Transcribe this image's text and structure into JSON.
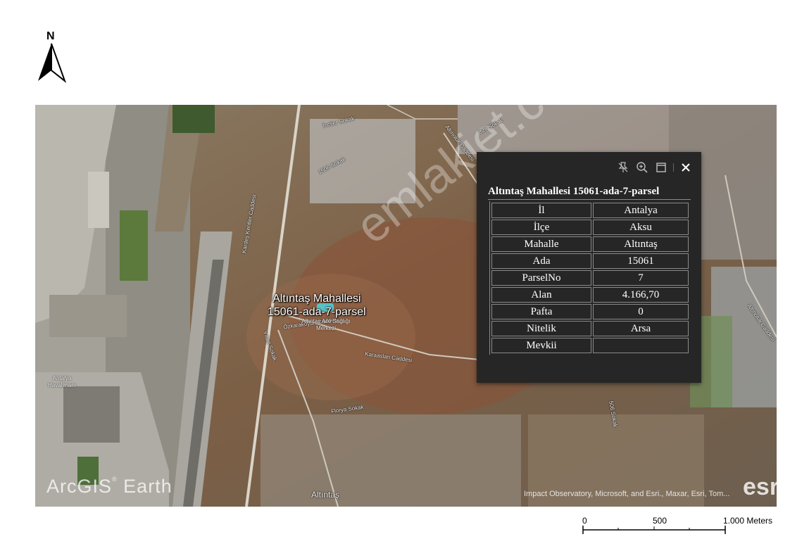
{
  "north_arrow": {
    "letter": "N"
  },
  "map": {
    "streets": [
      "İnciler Sokak",
      "1506 Sokak",
      "Altınoluk Caddesi",
      "826 Sokak",
      "Kardeş Kentler Caddesi",
      "Özkarakoyun Caddesi",
      "Yıldız Sokak",
      "Karaaslan Caddesi",
      "Florya Sokak",
      "Altınoluk Caddesi",
      "506 Sokak"
    ],
    "places": {
      "airport": "Antalya Havalimanı",
      "health_center": "Altıntaş Aile Sağlığı Merkezi",
      "neighborhood": "Altıntaş"
    },
    "parcel_label": [
      "Altıntaş Mahallesi",
      "15061-ada-7-parsel"
    ],
    "watermark": "emlakjet.com",
    "arcgis_logo": "ArcGIS",
    "arcgis_logo_reg": "®",
    "arcgis_logo_earth": "Earth",
    "attribution": "Impact Observatory, Microsoft, and Esri., Maxar, Esri, Tom...",
    "esri_logo": "esri"
  },
  "popup": {
    "title": "Altıntaş Mahallesi 15061-ada-7-parsel",
    "tools": [
      "pin-icon",
      "zoom-to-icon",
      "maximize-icon",
      "close-icon"
    ],
    "rows": [
      {
        "key": "İl",
        "value": "Antalya"
      },
      {
        "key": "İlçe",
        "value": "Aksu"
      },
      {
        "key": "Mahalle",
        "value": "Altıntaş"
      },
      {
        "key": "Ada",
        "value": "15061"
      },
      {
        "key": "ParselNo",
        "value": "7"
      },
      {
        "key": "Alan",
        "value": "4.166,70"
      },
      {
        "key": "Pafta",
        "value": "0"
      },
      {
        "key": "Nitelik",
        "value": "Arsa"
      },
      {
        "key": "Mevkii",
        "value": ""
      }
    ]
  },
  "scalebar": {
    "labels": [
      "0",
      "500",
      "1.000 Meters"
    ]
  }
}
